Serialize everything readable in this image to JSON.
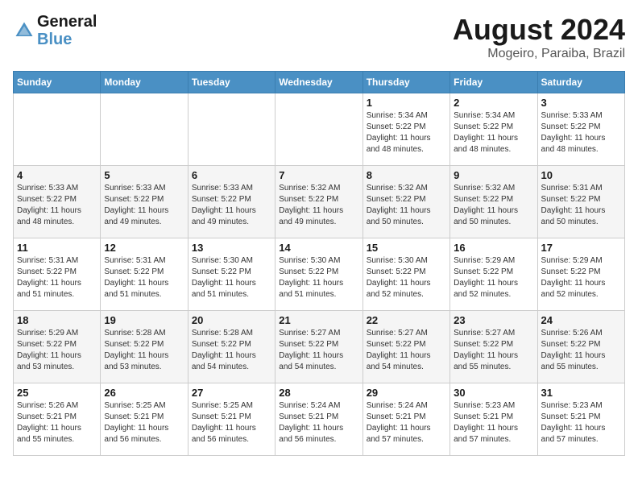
{
  "header": {
    "logo_line1": "General",
    "logo_line2": "Blue",
    "main_title": "August 2024",
    "subtitle": "Mogeiro, Paraiba, Brazil"
  },
  "calendar": {
    "days_of_week": [
      "Sunday",
      "Monday",
      "Tuesday",
      "Wednesday",
      "Thursday",
      "Friday",
      "Saturday"
    ],
    "weeks": [
      [
        {
          "day": "",
          "info": ""
        },
        {
          "day": "",
          "info": ""
        },
        {
          "day": "",
          "info": ""
        },
        {
          "day": "",
          "info": ""
        },
        {
          "day": "1",
          "info": "Sunrise: 5:34 AM\nSunset: 5:22 PM\nDaylight: 11 hours\nand 48 minutes."
        },
        {
          "day": "2",
          "info": "Sunrise: 5:34 AM\nSunset: 5:22 PM\nDaylight: 11 hours\nand 48 minutes."
        },
        {
          "day": "3",
          "info": "Sunrise: 5:33 AM\nSunset: 5:22 PM\nDaylight: 11 hours\nand 48 minutes."
        }
      ],
      [
        {
          "day": "4",
          "info": "Sunrise: 5:33 AM\nSunset: 5:22 PM\nDaylight: 11 hours\nand 48 minutes."
        },
        {
          "day": "5",
          "info": "Sunrise: 5:33 AM\nSunset: 5:22 PM\nDaylight: 11 hours\nand 49 minutes."
        },
        {
          "day": "6",
          "info": "Sunrise: 5:33 AM\nSunset: 5:22 PM\nDaylight: 11 hours\nand 49 minutes."
        },
        {
          "day": "7",
          "info": "Sunrise: 5:32 AM\nSunset: 5:22 PM\nDaylight: 11 hours\nand 49 minutes."
        },
        {
          "day": "8",
          "info": "Sunrise: 5:32 AM\nSunset: 5:22 PM\nDaylight: 11 hours\nand 50 minutes."
        },
        {
          "day": "9",
          "info": "Sunrise: 5:32 AM\nSunset: 5:22 PM\nDaylight: 11 hours\nand 50 minutes."
        },
        {
          "day": "10",
          "info": "Sunrise: 5:31 AM\nSunset: 5:22 PM\nDaylight: 11 hours\nand 50 minutes."
        }
      ],
      [
        {
          "day": "11",
          "info": "Sunrise: 5:31 AM\nSunset: 5:22 PM\nDaylight: 11 hours\nand 51 minutes."
        },
        {
          "day": "12",
          "info": "Sunrise: 5:31 AM\nSunset: 5:22 PM\nDaylight: 11 hours\nand 51 minutes."
        },
        {
          "day": "13",
          "info": "Sunrise: 5:30 AM\nSunset: 5:22 PM\nDaylight: 11 hours\nand 51 minutes."
        },
        {
          "day": "14",
          "info": "Sunrise: 5:30 AM\nSunset: 5:22 PM\nDaylight: 11 hours\nand 51 minutes."
        },
        {
          "day": "15",
          "info": "Sunrise: 5:30 AM\nSunset: 5:22 PM\nDaylight: 11 hours\nand 52 minutes."
        },
        {
          "day": "16",
          "info": "Sunrise: 5:29 AM\nSunset: 5:22 PM\nDaylight: 11 hours\nand 52 minutes."
        },
        {
          "day": "17",
          "info": "Sunrise: 5:29 AM\nSunset: 5:22 PM\nDaylight: 11 hours\nand 52 minutes."
        }
      ],
      [
        {
          "day": "18",
          "info": "Sunrise: 5:29 AM\nSunset: 5:22 PM\nDaylight: 11 hours\nand 53 minutes."
        },
        {
          "day": "19",
          "info": "Sunrise: 5:28 AM\nSunset: 5:22 PM\nDaylight: 11 hours\nand 53 minutes."
        },
        {
          "day": "20",
          "info": "Sunrise: 5:28 AM\nSunset: 5:22 PM\nDaylight: 11 hours\nand 54 minutes."
        },
        {
          "day": "21",
          "info": "Sunrise: 5:27 AM\nSunset: 5:22 PM\nDaylight: 11 hours\nand 54 minutes."
        },
        {
          "day": "22",
          "info": "Sunrise: 5:27 AM\nSunset: 5:22 PM\nDaylight: 11 hours\nand 54 minutes."
        },
        {
          "day": "23",
          "info": "Sunrise: 5:27 AM\nSunset: 5:22 PM\nDaylight: 11 hours\nand 55 minutes."
        },
        {
          "day": "24",
          "info": "Sunrise: 5:26 AM\nSunset: 5:22 PM\nDaylight: 11 hours\nand 55 minutes."
        }
      ],
      [
        {
          "day": "25",
          "info": "Sunrise: 5:26 AM\nSunset: 5:21 PM\nDaylight: 11 hours\nand 55 minutes."
        },
        {
          "day": "26",
          "info": "Sunrise: 5:25 AM\nSunset: 5:21 PM\nDaylight: 11 hours\nand 56 minutes."
        },
        {
          "day": "27",
          "info": "Sunrise: 5:25 AM\nSunset: 5:21 PM\nDaylight: 11 hours\nand 56 minutes."
        },
        {
          "day": "28",
          "info": "Sunrise: 5:24 AM\nSunset: 5:21 PM\nDaylight: 11 hours\nand 56 minutes."
        },
        {
          "day": "29",
          "info": "Sunrise: 5:24 AM\nSunset: 5:21 PM\nDaylight: 11 hours\nand 57 minutes."
        },
        {
          "day": "30",
          "info": "Sunrise: 5:23 AM\nSunset: 5:21 PM\nDaylight: 11 hours\nand 57 minutes."
        },
        {
          "day": "31",
          "info": "Sunrise: 5:23 AM\nSunset: 5:21 PM\nDaylight: 11 hours\nand 57 minutes."
        }
      ]
    ]
  }
}
